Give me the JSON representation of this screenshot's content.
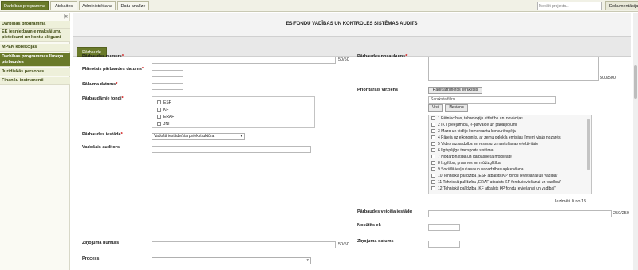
{
  "topnav": {
    "tabs": [
      "Darbības programma",
      "Atskaites",
      "Administrēšana",
      "Datu analīze"
    ],
    "search_placeholder": "Meklēt projektu...",
    "doc_label": "Dokumentācija"
  },
  "sidebar": {
    "collapse_label": "|«",
    "items": [
      "Darbības programma",
      "EK iesniedzamie maksājumu pieteikumi un kontu slēgumi",
      "MPEK korekcijas",
      "Darbības programmas līmeņa pārbaudes",
      "Juridiskās personas",
      "Finanšu instrumenti"
    ]
  },
  "page": {
    "title": "ES FONDU VADĪBAS UN KONTROLES SISTĒMAS AUDITS",
    "tab": "Pārbaude"
  },
  "form": {
    "numurs_label": "Pārbaudes numurs",
    "numurs_counter": "50/50",
    "nosaukums_label": "Pārbaudes nosaukums",
    "nosaukums_counter": "500/500",
    "planotais_label": "Plānotais pārbaudes datums",
    "sakuma_label": "Sākuma datums",
    "fondi_label": "Pārbaudāmie fondi",
    "fondi": [
      "ESF",
      "KF",
      "ERAF",
      "JNI"
    ],
    "iestade_label": "Pārbaudes iestāde",
    "iestade_value": "Vadošā iestāde/starpniekstruktūra",
    "auditors_label": "Vadošais auditors",
    "prio_label": "Prioritārais virziens",
    "prio_button": "Rādīt atzīmētos ierakstus",
    "filter_placeholder": "Saraksta filtrs",
    "all_button": "Visi",
    "none_button": "Nevienu",
    "prio_items": [
      "1 Pētniecības, tehnoloģiju attīstība un inovācijas",
      "2 IKT pieejamība, e-pārvalde un pakalpojumi",
      "3 Mazo un vidējo komersantu konkurētspēja",
      "4 Pāreja uz ekonomiku ar zemu oglekļa emisijas līmeni visās nozarēs",
      "5 Vides aizsardzība un resursu izmantošanas efektivitāte",
      "6 Ilgtspējīga transporta sistēma",
      "7 Nodarbinātība un darbaspēka mobilitāte",
      "8 Izglītība, prasmes un mūžizglītība",
      "9 Sociālā iekļaušana un nabadzības apkarošana",
      "10 Tehniskā palīdzība „ESF atbalsts KP fondu ieviešanai un vadībai”",
      "11 Tehniskā palīdzība „ERAF atbalsts KP fondu ieviešanai un vadībai”",
      "12 Tehniskā palīdzība „KF atbalsts KP fondu ieviešanai un vadībai”"
    ],
    "selected_summary": "Iezīmēti 0 no 15",
    "veiceja_label": "Pārbaudes veicēja iestāde",
    "veiceja_counter": "250/250",
    "nosutits_label": "Nosūtīts ek",
    "zinojuma_numurs_label": "Ziņojuma numurs",
    "zinojuma_counter": "50/50",
    "zinojuma_datums_label": "Ziņojuma datums",
    "process_label": "Process"
  }
}
